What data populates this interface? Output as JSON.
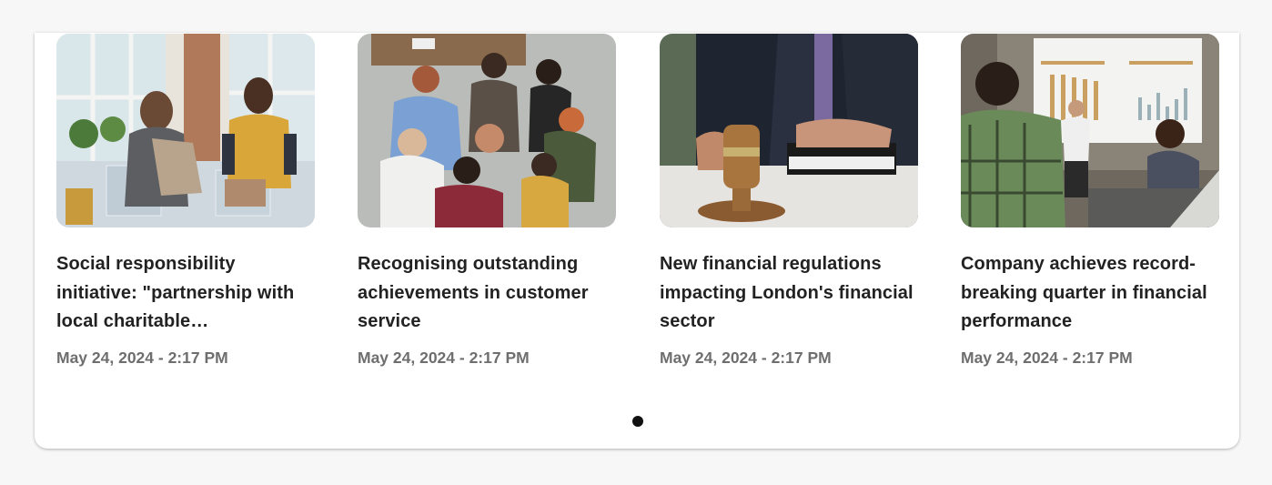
{
  "articles": [
    {
      "title": "Social responsibility initiative: \"partnership with local charitable…",
      "date": "May 24, 2024 - 2:17 PM",
      "image_icon": "charity-volunteers-photo"
    },
    {
      "title": "Recognising outstanding achievements in customer service",
      "date": "May 24, 2024 - 2:17 PM",
      "image_icon": "team-hands-photo"
    },
    {
      "title": "New financial regulations impacting London's financial sector",
      "date": "May 24, 2024 - 2:17 PM",
      "image_icon": "gavel-photo"
    },
    {
      "title": "Company achieves record-breaking quarter in financial performance",
      "date": "May 24, 2024 - 2:17 PM",
      "image_icon": "presentation-photo"
    }
  ],
  "carousel": {
    "pages": 1,
    "active_page": 1
  },
  "colors": {
    "title": "#222222",
    "date": "#6e6e6e",
    "dot": "#111111",
    "panel": "#ffffff",
    "background": "#f7f7f7"
  }
}
